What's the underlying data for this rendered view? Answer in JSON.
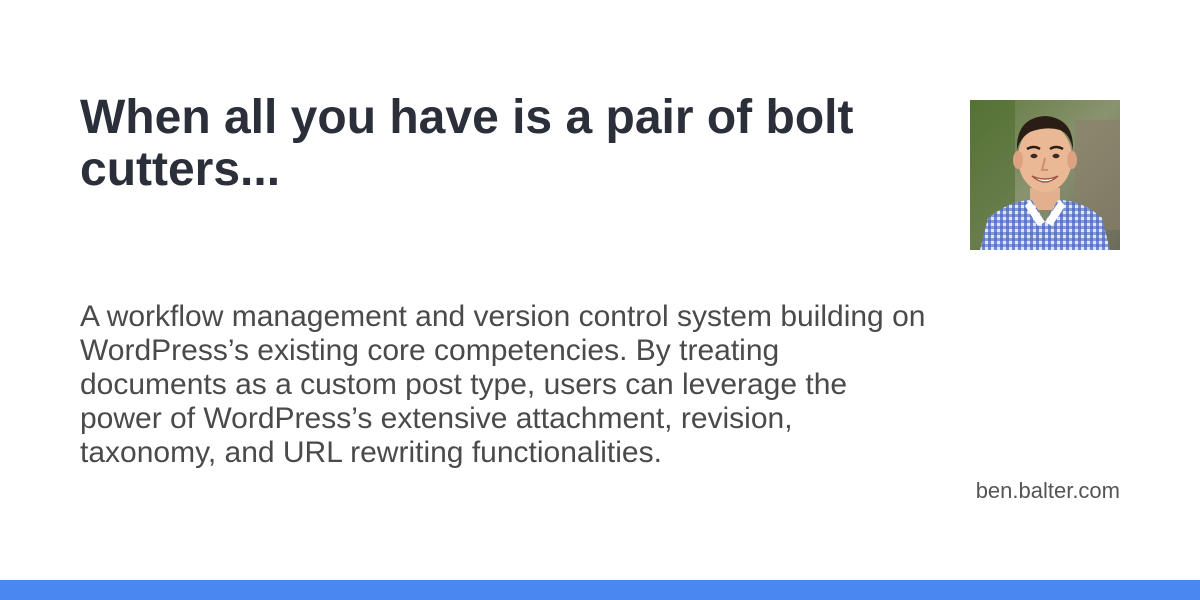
{
  "title": "When all you have is a pair of bolt cutters...",
  "description": "A workflow management and version control system building on WordPress’s existing core competencies. By treating documents as a custom post type, users can leverage the power of WordPress’s extensive attachment, revision, taxonomy, and URL rewriting functionalities.",
  "site": "ben.balter.com",
  "avatar_icon": "author-photo",
  "colors": {
    "title": "#2b2f3a",
    "text": "#4a4a4a",
    "accent_bar": "#4a87f0"
  }
}
